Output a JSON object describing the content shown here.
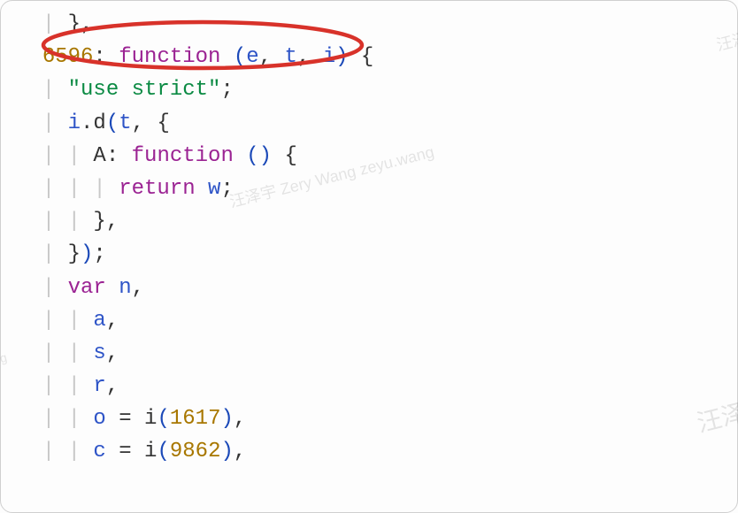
{
  "code": {
    "line1": {
      "brace": "}",
      "comma": ","
    },
    "line2": {
      "num": "6596",
      "colon": ":",
      "keyword": "function",
      "paren_open": "(",
      "a": "e",
      "c1": ",",
      "b": "t",
      "c2": ",",
      "d": "i",
      "paren_close": ")",
      "brace": "{"
    },
    "line3": {
      "string": "\"use strict\"",
      "semi": ";"
    },
    "line4": {
      "obj": "i",
      "dot": ".",
      "method": "d",
      "paren_open": "(",
      "arg": "t",
      "comma": ",",
      "brace": "{"
    },
    "line5": {
      "prop": "A",
      "colon": ":",
      "keyword": "function",
      "paren_open": "(",
      "paren_close": ")",
      "brace": "{"
    },
    "line6": {
      "keyword": "return",
      "ident": "w",
      "semi": ";"
    },
    "line7": {
      "brace": "}",
      "comma": ","
    },
    "line8": {
      "brace": "}",
      "paren_close": ")",
      "semi": ";"
    },
    "line9": {
      "keyword": "var",
      "ident": "n",
      "comma": ","
    },
    "line10": {
      "ident": "a",
      "comma": ","
    },
    "line11": {
      "ident": "s",
      "comma": ","
    },
    "line12": {
      "ident": "r",
      "comma": ","
    },
    "line13": {
      "ident": "o",
      "eq": "=",
      "fn": "i",
      "paren_open": "(",
      "num": "1617",
      "paren_close": ")",
      "comma": ","
    },
    "line14": {
      "ident": "c",
      "eq": "=",
      "fn": "i",
      "paren_open": "(",
      "num": "9862",
      "paren_close": ")",
      "comma": ","
    }
  },
  "watermarks": {
    "w1": "汪泽宇 Zery Wang zeyu.wang",
    "w2": "u.wang",
    "w3": "汪泽",
    "w4": "汪泽宇"
  }
}
